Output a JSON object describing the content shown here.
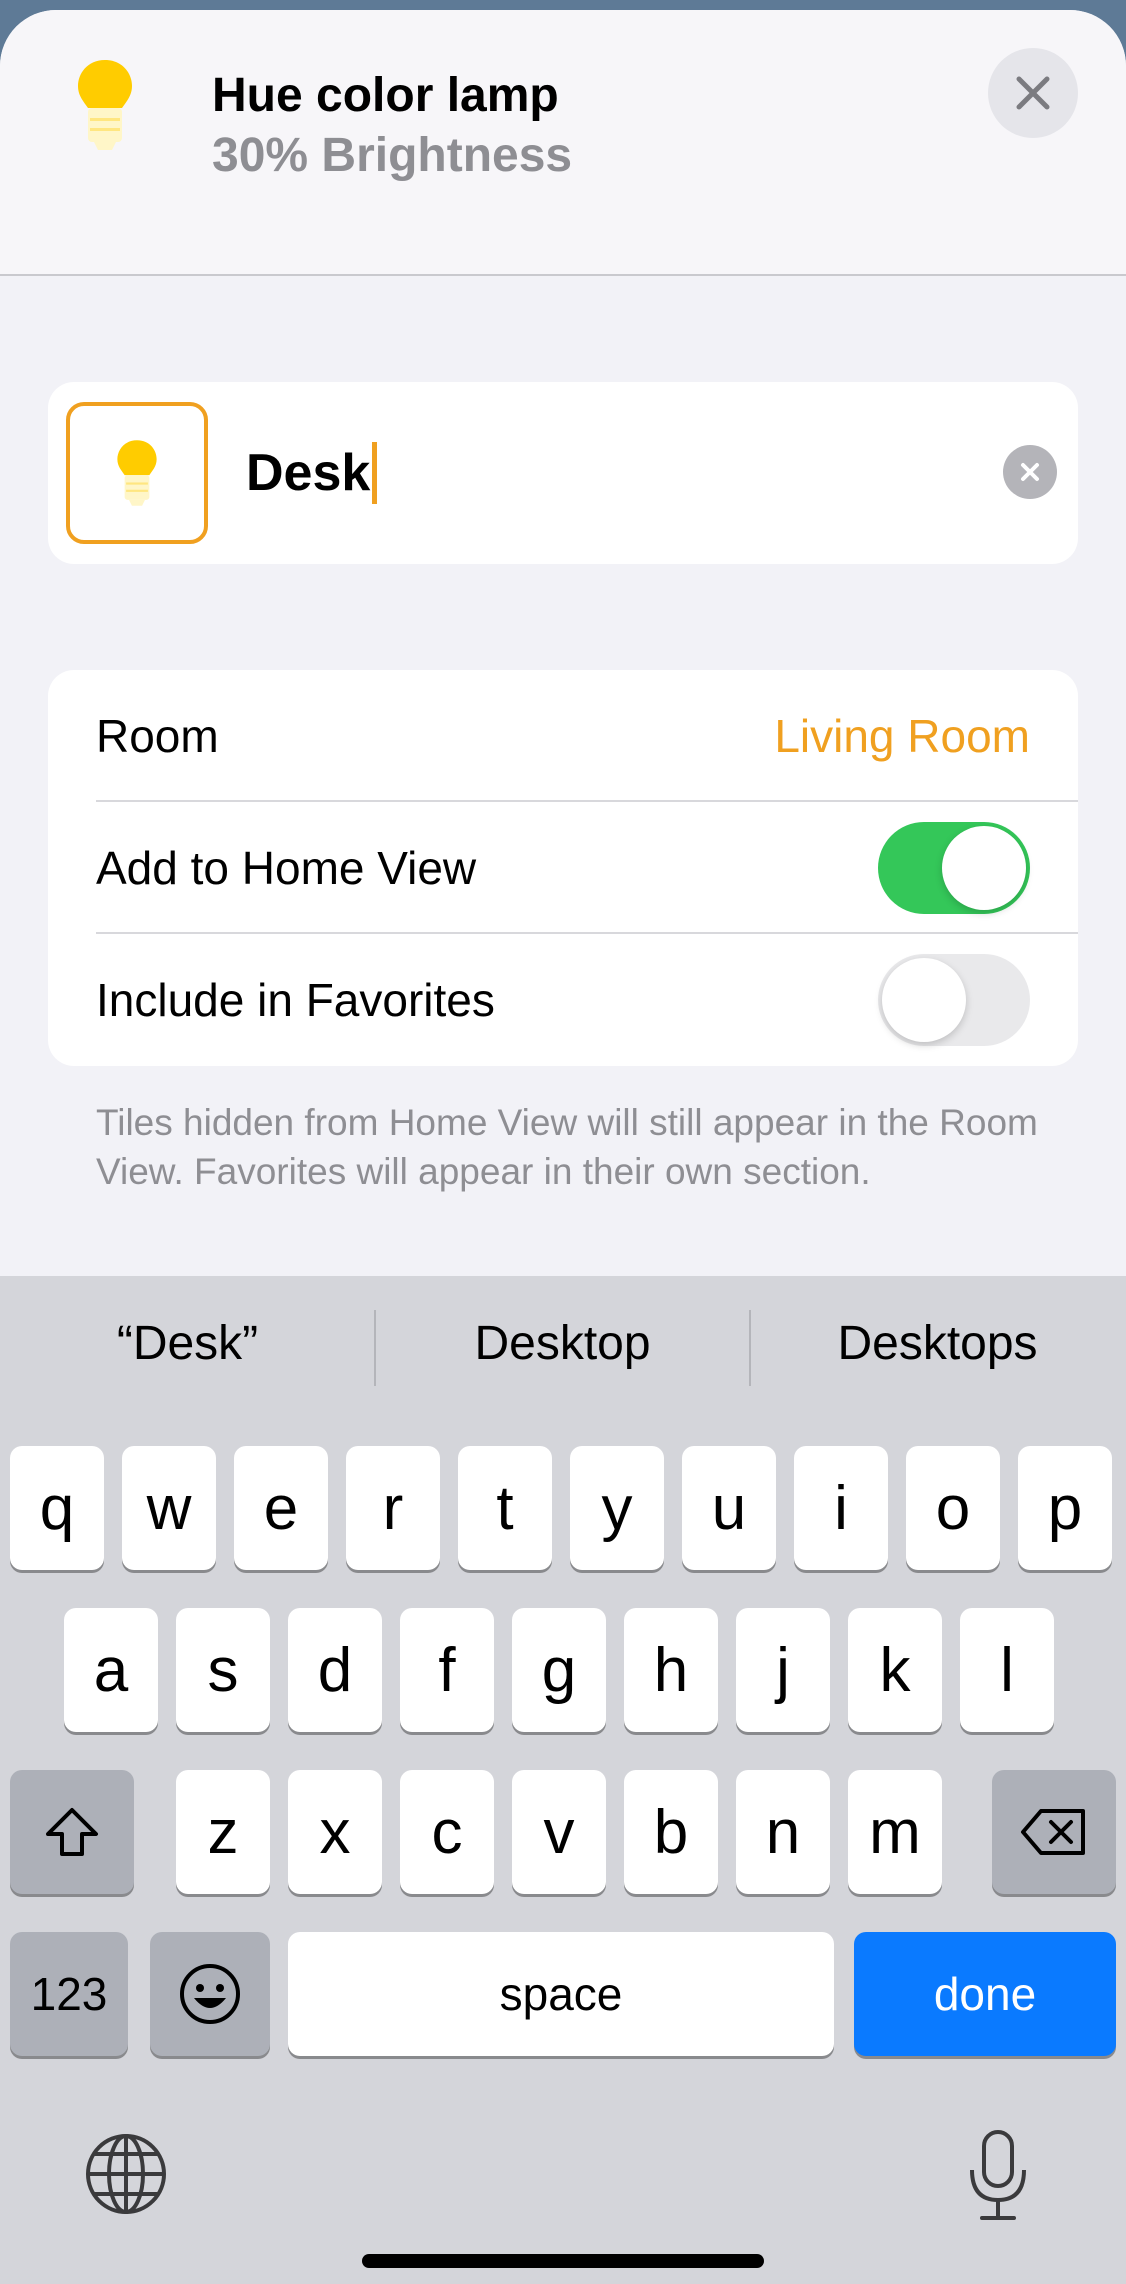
{
  "header": {
    "device_name": "Hue color lamp",
    "device_status": "30% Brightness",
    "icon": "lightbulb-icon",
    "close_icon": "close-icon"
  },
  "name_field": {
    "value": "Desk",
    "icon": "lightbulb-icon",
    "clear_icon": "clear-icon"
  },
  "settings": {
    "room_label": "Room",
    "room_value": "Living Room",
    "home_view_label": "Add to Home View",
    "home_view_on": true,
    "favorites_label": "Include in Favorites",
    "favorites_on": false
  },
  "footnote": "Tiles hidden from Home View will still appear in the Room View. Favorites will appear in their own section.",
  "keyboard": {
    "suggestions": [
      "“Desk”",
      "Desktop",
      "Desktops"
    ],
    "row1": [
      "q",
      "w",
      "e",
      "r",
      "t",
      "y",
      "u",
      "i",
      "o",
      "p"
    ],
    "row2": [
      "a",
      "s",
      "d",
      "f",
      "g",
      "h",
      "j",
      "k",
      "l"
    ],
    "row3": [
      "z",
      "x",
      "c",
      "v",
      "b",
      "n",
      "m"
    ],
    "numbers_label": "123",
    "space_label": "space",
    "done_label": "done",
    "shift_icon": "shift-icon",
    "delete_icon": "delete-icon",
    "emoji_icon": "emoji-icon",
    "globe_icon": "globe-icon",
    "mic_icon": "microphone-icon"
  },
  "colors": {
    "accent": "#f0a020",
    "toggle_on": "#34c759",
    "done_key": "#0a7aff"
  }
}
